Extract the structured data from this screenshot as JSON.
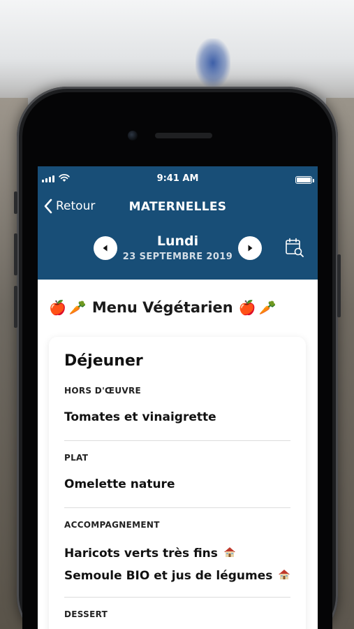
{
  "status_bar": {
    "time": "9:41 AM"
  },
  "nav": {
    "back_label": "Retour",
    "title": "MATERNELLES"
  },
  "date_selector": {
    "day": "Lundi",
    "date": "23 SEPTEMBRE 2019"
  },
  "menu": {
    "heading": "Menu Végétarien",
    "heading_emojis": [
      "🍎",
      "🥕"
    ],
    "meal_title": "Déjeuner",
    "sections": [
      {
        "label": "HORS D'ŒUVRE",
        "value": "Tomates et vinaigrette"
      },
      {
        "label": "PLAT",
        "value": "Omelette nature"
      },
      {
        "label": "ACCOMPAGNEMENT",
        "value_part1": "Haricots verts très fins",
        "value_part2": "Semoule",
        "value_part3": "BIO et jus de légumes"
      },
      {
        "label": "DESSERT"
      }
    ]
  },
  "colors": {
    "header_bg": "#184e77",
    "card_bg": "#ffffff",
    "text": "#111111"
  },
  "icons": [
    "signal-icon",
    "wifi-icon",
    "battery-icon",
    "chevron-left-icon",
    "previous-day-icon",
    "next-day-icon",
    "calendar-search-icon",
    "homemade-icon"
  ]
}
